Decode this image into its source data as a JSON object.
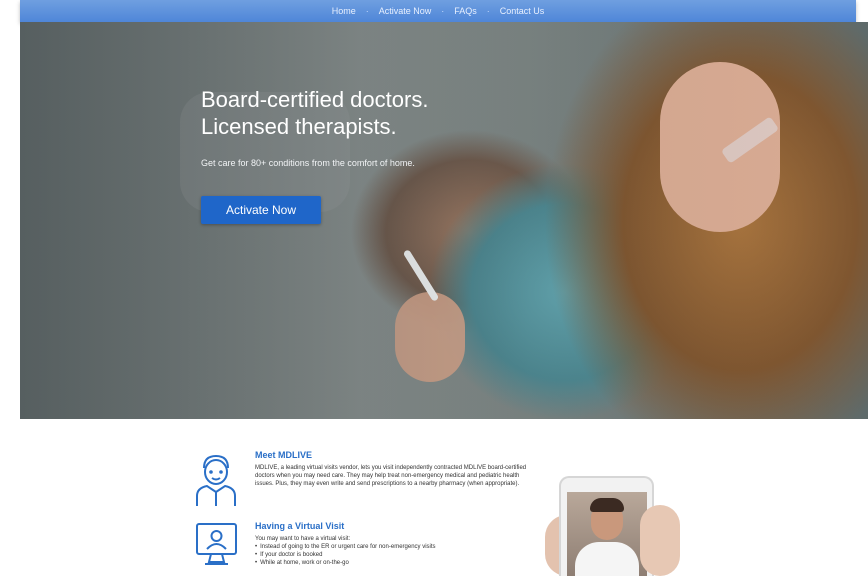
{
  "nav": {
    "items": [
      "Home",
      "Activate Now",
      "FAQs",
      "Contact Us"
    ],
    "separator": "·"
  },
  "hero": {
    "title_line1": "Board-certified doctors.",
    "title_line2": "Licensed therapists.",
    "subtitle": "Get care for 80+ conditions from the comfort of home.",
    "cta_label": "Activate Now"
  },
  "meet": {
    "title": "Meet MDLIVE",
    "text": "MDLIVE, a leading virtual visits vendor, lets you visit independently contracted MDLIVE board-certified doctors when you may need care. They may help treat non-emergency medical and pediatric health issues. Plus, they may even write and send prescriptions to a nearby pharmacy (when appropriate)."
  },
  "visit": {
    "title": "Having a Virtual Visit",
    "intro": "You may want to have a virtual visit:",
    "bullets": [
      "Instead of going to the ER or urgent care for non-emergency visits",
      "If your doctor is booked",
      "While at home, work or on-the-go"
    ]
  },
  "colors": {
    "brand_blue": "#1f66c9",
    "heading_blue": "#2a6fc7",
    "icon_blue": "#2a6fc7"
  },
  "icons": {
    "meet": "doctor-icon",
    "visit": "monitor-user-icon"
  }
}
